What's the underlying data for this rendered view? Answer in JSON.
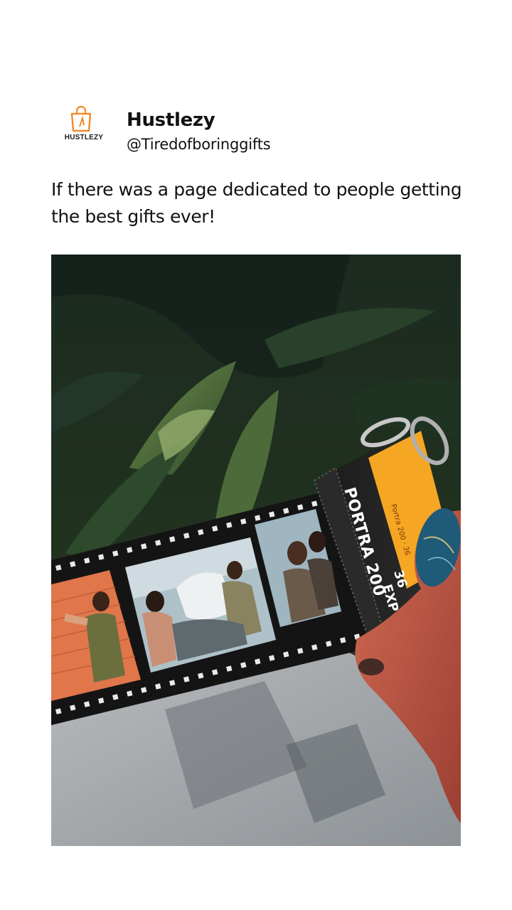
{
  "post": {
    "account": {
      "logo_text": "HUSTLEZY",
      "name": "Hustlezy",
      "handle": "@Tiredofboringgifts"
    },
    "caption": "If there was a page dedicated to people getting the best gifts ever!",
    "image": {
      "film_label": "PORTRA 200",
      "film_exposures": "36",
      "film_exp_label": "EXP",
      "film_small_label": "Portra 200 · 36"
    }
  },
  "colors": {
    "logo_orange": "#f28a2e",
    "canister_yellow": "#f5a623",
    "film_black": "#141414",
    "nail_blue": "#1f5a78"
  }
}
